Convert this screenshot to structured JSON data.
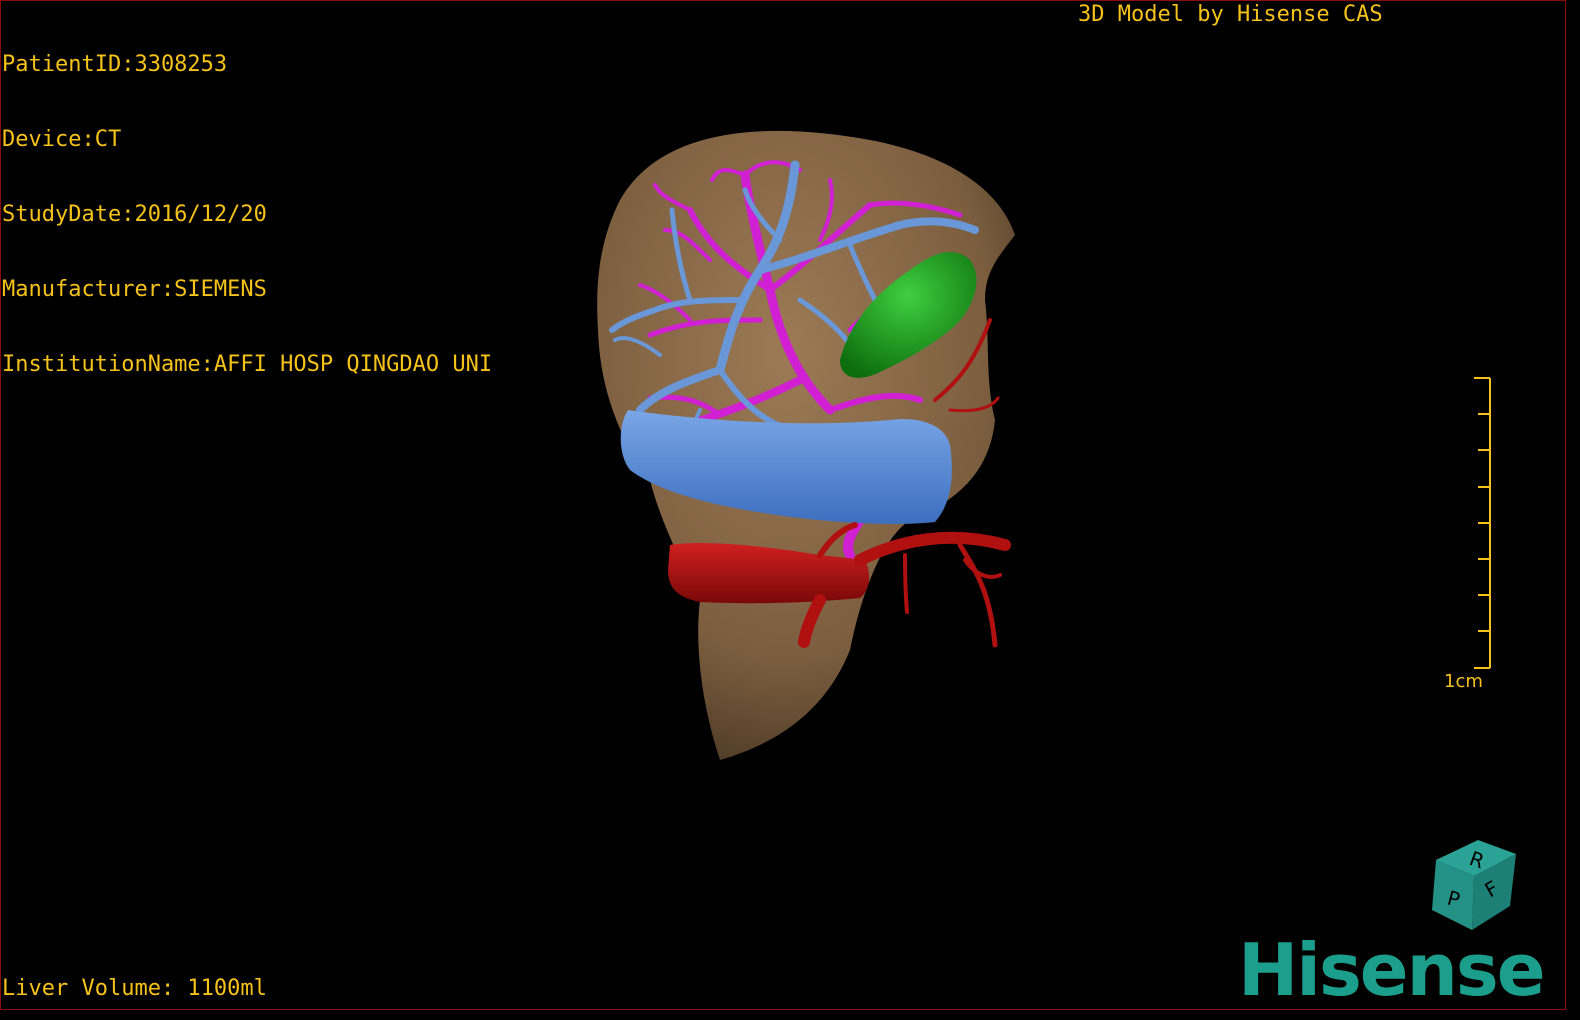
{
  "dicom_info": [
    "PatientID:3308253",
    "Device:CT",
    "StudyDate:2016/12/20",
    "Manufacturer:SIEMENS",
    "InstitutionName:AFFI HOSP QINGDAO UNI"
  ],
  "credit": "3D Model by Hisense CAS",
  "volume": "Liver Volume: 1100ml",
  "scale_label": "1cm",
  "brand": "Hisense",
  "orientation_cube": {
    "top": "R",
    "right": "F",
    "front": "P"
  },
  "colors": {
    "text": "#f5c21a",
    "liver": "#8a6a48",
    "portal_vein": "#5b8ad4",
    "hepatic_vein": "#d11fd4",
    "gallbladder": "#1fa11f",
    "artery": "#b01010",
    "brand": "#1b9e8c"
  }
}
